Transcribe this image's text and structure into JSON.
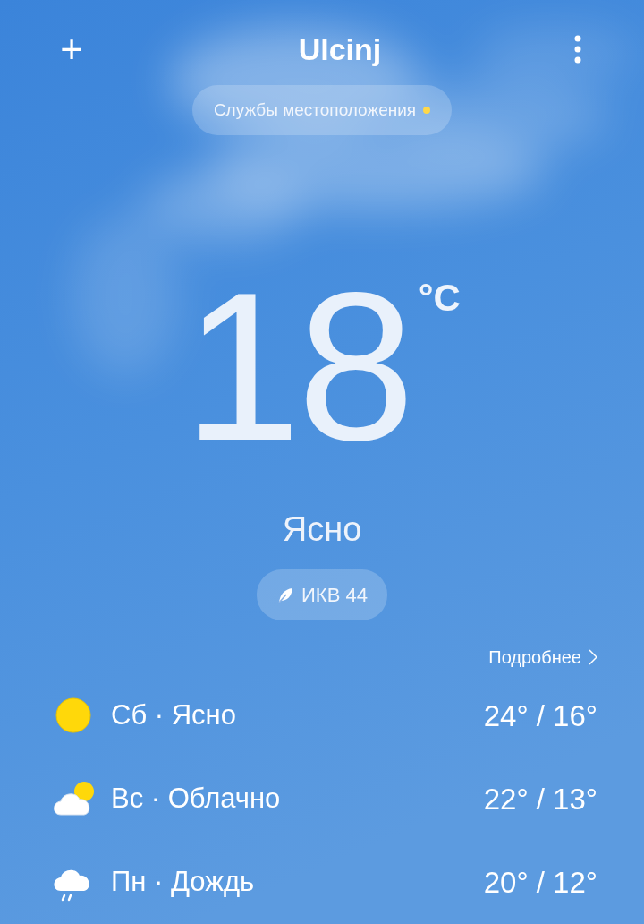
{
  "header": {
    "add_button": "+",
    "city": "Ulcinj"
  },
  "location_services": {
    "label": "Службы местоположения"
  },
  "current": {
    "temperature": "18",
    "unit": "°C",
    "condition": "Ясно"
  },
  "aqi": {
    "label": "ИКВ 44"
  },
  "details_link": "Подробнее",
  "forecast": [
    {
      "kind": "sun",
      "label": "Сб · Ясно",
      "temps": "24° / 16°"
    },
    {
      "kind": "partly_cloudy",
      "label": "Вс · Облачно",
      "temps": "22° / 13°"
    },
    {
      "kind": "rain",
      "label": "Пн · Дождь",
      "temps": "20° / 12°"
    }
  ]
}
